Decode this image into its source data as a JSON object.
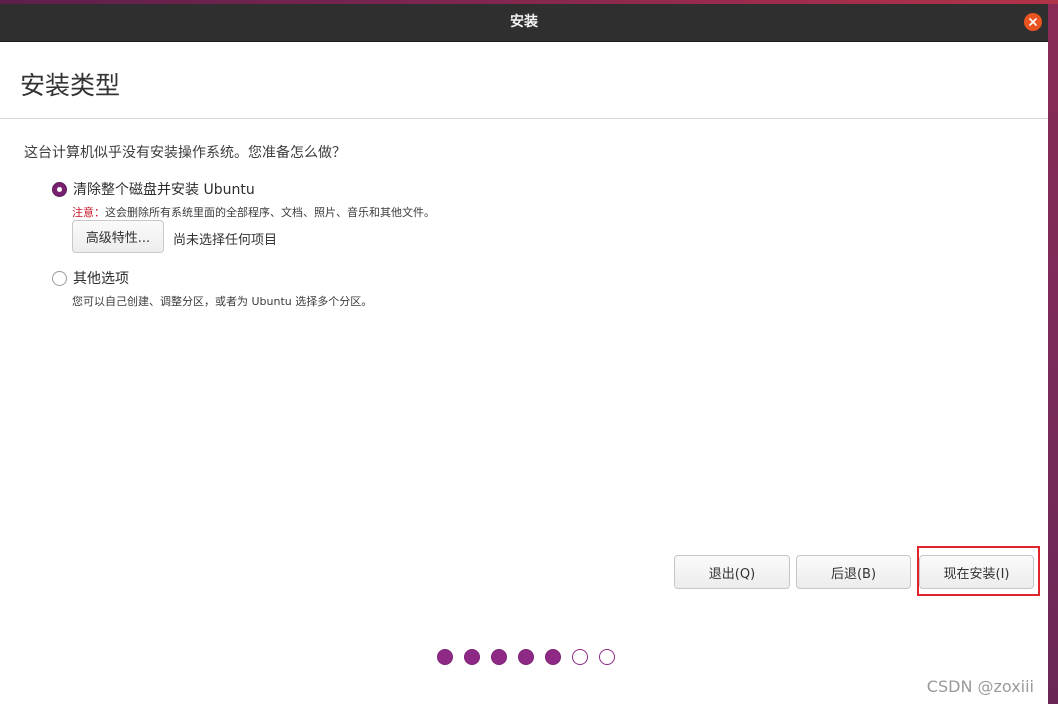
{
  "window": {
    "title": "安装"
  },
  "page": {
    "title": "安装类型",
    "question": "这台计算机似乎没有安装操作系统。您准备怎么做？"
  },
  "options": [
    {
      "label": "清除整个磁盘并安装 Ubuntu",
      "checked": true,
      "note_prefix": "注意：",
      "note_text": "这会删除所有系统里面的全部程序、文档、照片、音乐和其他文件。",
      "advanced_button": "高级特性...",
      "advanced_status": "尚未选择任何项目"
    },
    {
      "label": "其他选项",
      "checked": false,
      "description": "您可以自己创建、调整分区，或者为 Ubuntu 选择多个分区。"
    }
  ],
  "buttons": {
    "quit": "退出(Q)",
    "back": "后退(B)",
    "install_now": "现在安装(I)"
  },
  "progress": {
    "total_steps": 7,
    "completed_steps": 5
  },
  "watermark": "CSDN @zoxiii",
  "colors": {
    "accent": "#77216f",
    "close": "#e95420",
    "warning": "#c7162b",
    "highlight": "#e0242b"
  },
  "icons": {
    "close": "close-icon"
  }
}
